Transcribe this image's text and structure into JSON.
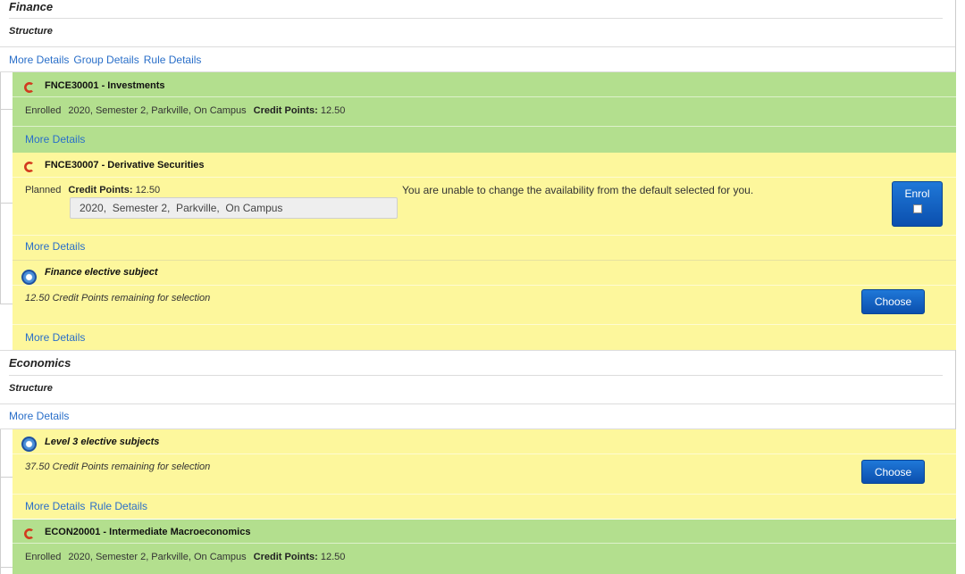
{
  "finance": {
    "title": "Finance",
    "structure_label": "Structure",
    "links": [
      "More Details",
      "Group Details",
      "Rule Details"
    ]
  },
  "subjects": {
    "fnce30001": {
      "title": "FNCE30001 - Investments",
      "status": "Enrolled",
      "availability": "2020, Semester 2, Parkville, On Campus",
      "credit_label": "Credit Points:",
      "credit_value": "12.50",
      "more_details": "More Details"
    },
    "fnce30007": {
      "title": "FNCE30007 - Derivative Securities",
      "status": "Planned",
      "credit_label": "Credit Points:",
      "credit_value": "12.50",
      "availability_select": "2020,  Semester 2,  Parkville,  On Campus",
      "notice": "You are unable to change the availability from the default selected for you.",
      "enrol_label": "Enrol",
      "more_details": "More Details"
    },
    "finance_elective": {
      "title": "Finance elective subject",
      "remaining": "12.50 Credit Points remaining for selection",
      "choose_label": "Choose",
      "more_details": "More Details"
    }
  },
  "economics": {
    "title": "Economics",
    "structure_label": "Structure",
    "links": [
      "More Details"
    ]
  },
  "economics_subjects": {
    "level3_elective": {
      "title": "Level 3 elective subjects",
      "remaining": "37.50 Credit Points remaining for selection",
      "choose_label": "Choose",
      "links": [
        "More Details",
        "Rule Details"
      ]
    },
    "econ20001": {
      "title": "ECON20001 - Intermediate Macroeconomics",
      "status": "Enrolled",
      "availability": "2020, Semester 2, Parkville, On Campus",
      "credit_label": "Credit Points:",
      "credit_value": "12.50"
    }
  },
  "colors": {
    "enrolled_bg": "#b3df8e",
    "planned_bg": "#fdf79c",
    "link": "#2a6fc9",
    "button": "#1f78d8"
  },
  "icons": {
    "core_subject": "red-c-icon",
    "elective_group": "blue-ring-icon"
  }
}
